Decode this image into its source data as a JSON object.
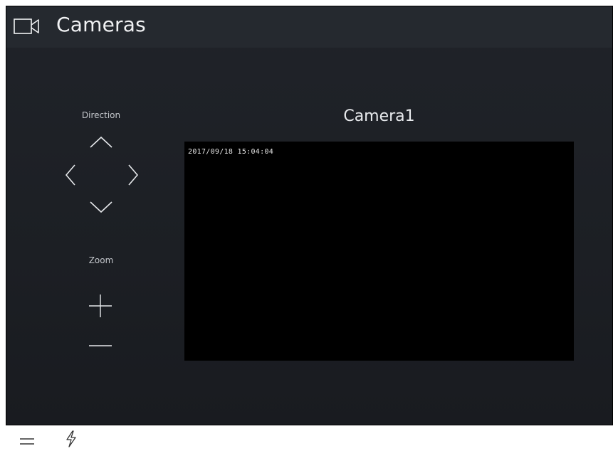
{
  "header": {
    "title": "Cameras",
    "icon": "video-camera-icon"
  },
  "controls": {
    "direction_label": "Direction",
    "zoom_label": "Zoom",
    "icons": {
      "up": "chevron-up-icon",
      "down": "chevron-down-icon",
      "left": "chevron-left-icon",
      "right": "chevron-right-icon",
      "zoom_in": "plus-icon",
      "zoom_out": "minus-icon"
    }
  },
  "camera": {
    "name": "Camera1",
    "timestamp": "2017/09/18 15:04:04"
  },
  "bottombar": {
    "menu_icon": "menu-icon",
    "power_icon": "lightning-icon"
  },
  "colors": {
    "background": "#1e2126",
    "header": "#25292f",
    "video": "#000000",
    "text": "#f1f2f4"
  }
}
